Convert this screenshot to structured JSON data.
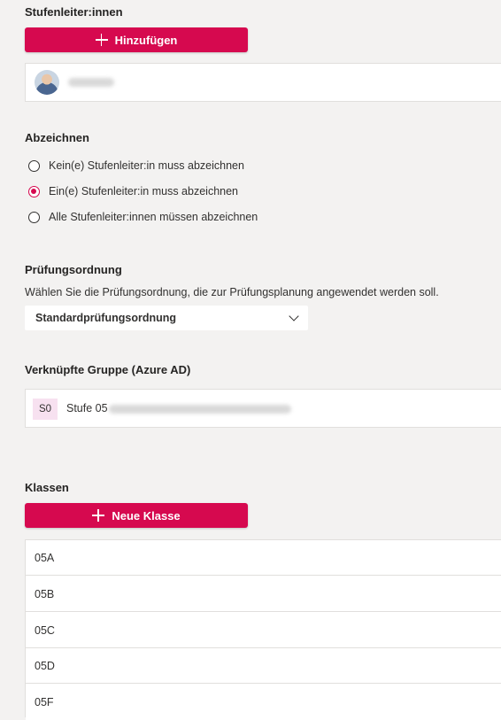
{
  "stufenleiter": {
    "title": "Stufenleiter:innen",
    "add_button_label": "Hinzufügen"
  },
  "abzeichnen": {
    "title": "Abzeichnen",
    "options": [
      {
        "label": "Kein(e) Stufenleiter:in muss abzeichnen",
        "checked": false
      },
      {
        "label": "Ein(e) Stufenleiter:in muss abzeichnen",
        "checked": true
      },
      {
        "label": "Alle Stufenleiter:innen müssen abzeichnen",
        "checked": false
      }
    ]
  },
  "pruefungsordnung": {
    "title": "Prüfungsordnung",
    "description": "Wählen Sie die Prüfungsordnung, die zur Prüfungsplanung angewendet werden soll.",
    "selected": "Standardprüfungsordnung"
  },
  "gruppe": {
    "title": "Verknüpfte Gruppe (Azure AD)",
    "badge": "S0",
    "name": "Stufe 05"
  },
  "klassen": {
    "title": "Klassen",
    "add_button_label": "Neue Klasse",
    "items": [
      "05A",
      "05B",
      "05C",
      "05D",
      "05F"
    ]
  },
  "colors": {
    "accent": "#d6094f",
    "background": "#f3f2f1",
    "badge_bg": "#f7e1f0"
  }
}
